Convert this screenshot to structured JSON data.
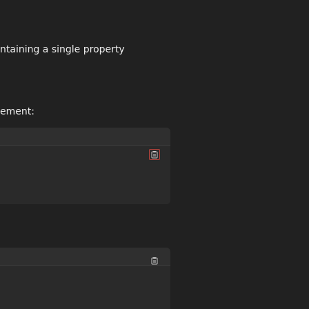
{
  "message": {
    "line1": "ntaining a single property",
    "line2": "ement:"
  },
  "code_blocks": [
    {
      "copy_icon": "clipboard-icon"
    },
    {
      "copy_icon": "clipboard-icon"
    }
  ],
  "colors": {
    "background": "#212121",
    "text": "#ececec",
    "code_header": "#2f2f2f",
    "code_body": "#2a2a2a",
    "divider": "#3f3f3f",
    "icon": "#c9c9c9",
    "icon_highlight": "#b9433b"
  }
}
